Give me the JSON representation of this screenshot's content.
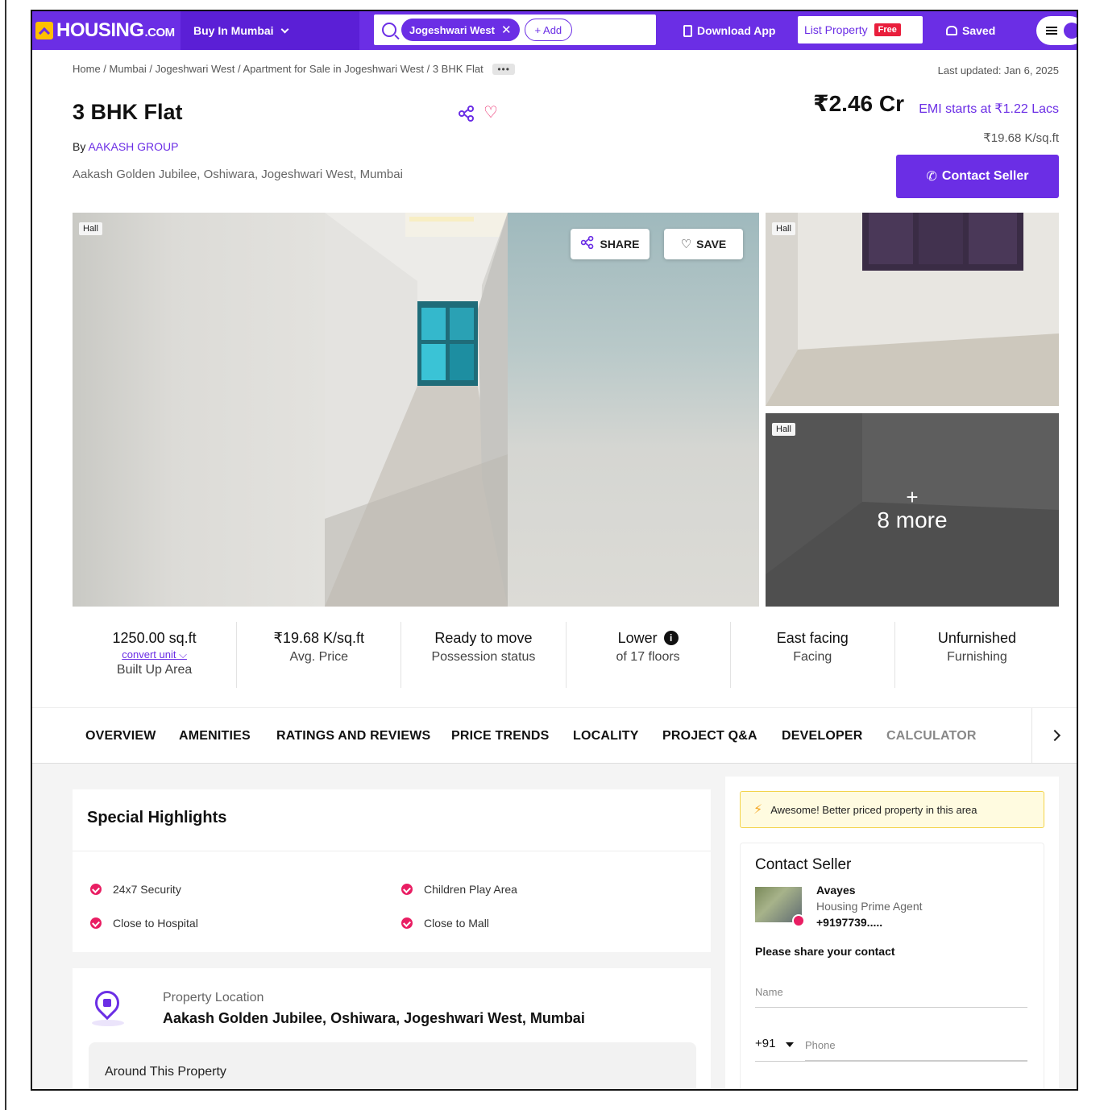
{
  "header": {
    "logo_main": "HOUSING",
    "logo_suffix": ".COM",
    "buy_label": "Buy In Mumbai",
    "search_chip": "Jogeshwari West",
    "add_label": "+ Add",
    "download_label": "Download App",
    "list_property_label": "List Property",
    "free_badge": "Free",
    "saved_label": "Saved"
  },
  "breadcrumb": {
    "items": [
      "Home",
      "Mumbai",
      "Jogeshwari West",
      "Apartment for Sale in Jogeshwari West",
      "3 BHK Flat"
    ],
    "separator": " / ",
    "more": "•••"
  },
  "last_updated": "Last updated: Jan 6, 2025",
  "property": {
    "title": "3 BHK Flat",
    "by_prefix": "By",
    "developer": "AAKASH GROUP",
    "address": "Aakash Golden Jubilee, Oshiwara, Jogeshwari West, Mumbai",
    "price": "₹2.46 Cr",
    "emi": "EMI starts at ₹1.22 Lacs",
    "price_per_sqft": "₹19.68 K/sq.ft",
    "contact_label": "Contact Seller"
  },
  "gallery": {
    "main_tag": "Hall",
    "side_top_tag": "Hall",
    "side_bottom_tag": "Hall",
    "share_label": "SHARE",
    "save_label": "SAVE",
    "more_plus": "+",
    "more_label": "8 more"
  },
  "stats": [
    {
      "value": "1250.00 sq.ft",
      "sub": "convert unit",
      "label": "Built Up Area"
    },
    {
      "value": "₹19.68 K/sq.ft",
      "label": "Avg. Price"
    },
    {
      "value": "Ready to move",
      "label": "Possession status"
    },
    {
      "value": "Lower",
      "label": "of 17 floors"
    },
    {
      "value": "East facing",
      "label": "Facing"
    },
    {
      "value": "Unfurnished",
      "label": "Furnishing"
    }
  ],
  "tabs": [
    "OVERVIEW",
    "AMENITIES",
    "RATINGS AND REVIEWS",
    "PRICE TRENDS",
    "LOCALITY",
    "PROJECT Q&A",
    "DEVELOPER",
    "CALCULATOR"
  ],
  "highlights": {
    "title": "Special Highlights",
    "items": [
      "24x7 Security",
      "Children Play Area",
      "Close to Hospital",
      "Close to Mall"
    ]
  },
  "location": {
    "label": "Property Location",
    "address": "Aakash Golden Jubilee, Oshiwara, Jogeshwari West, Mumbai",
    "around_label": "Around This Property"
  },
  "banner": "Awesome! Better priced property in this area",
  "seller": {
    "title": "Contact Seller",
    "name": "Avayes",
    "role": "Housing Prime Agent",
    "phone": "+9197739.....",
    "share_prompt": "Please share your contact",
    "name_placeholder": "Name",
    "country_code": "+91",
    "phone_placeholder": "Phone"
  },
  "colors": {
    "brand": "#6b2ee5",
    "accent_pink": "#e91e63",
    "logo_yellow": "#ffc000"
  }
}
